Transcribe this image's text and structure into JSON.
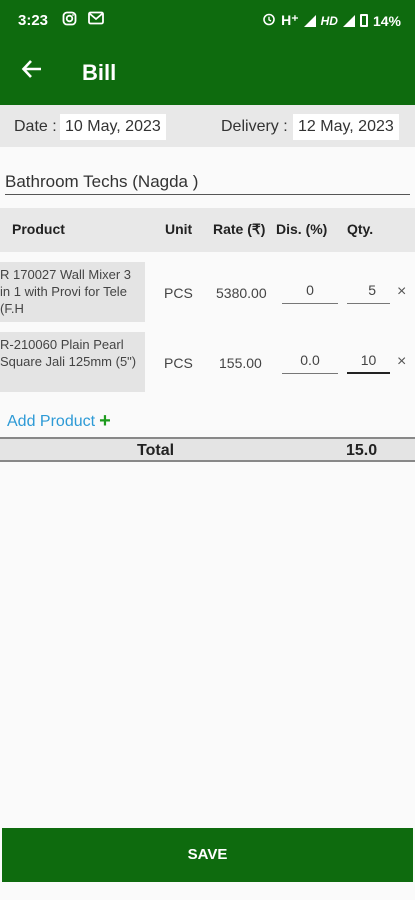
{
  "status_bar": {
    "time": "3:23",
    "network": "H⁺",
    "hd": "HD",
    "battery": "14%"
  },
  "app_bar": {
    "title": "Bill"
  },
  "dates": {
    "date_label": "Date :",
    "date_value": "10 May, 2023",
    "delivery_label": "Delivery :",
    "delivery_value": "12 May, 2023"
  },
  "customer": {
    "name": "Bathroom Techs (Nagda )"
  },
  "table": {
    "headers": {
      "product": "Product",
      "unit": "Unit",
      "rate": "Rate (₹)",
      "discount": "Dis. (%)",
      "qty": "Qty."
    },
    "rows": [
      {
        "product": "R 170027 Wall Mixer 3 in 1 with Provi for Tele (F.H",
        "unit": "PCS",
        "rate": "5380.00",
        "discount": "0",
        "qty": "5"
      },
      {
        "product": "R-210060 Plain Pearl Square Jali 125mm (5\")",
        "unit": "PCS",
        "rate": "155.00",
        "discount": "0.0",
        "qty": "10"
      }
    ],
    "remove_symbol": "×"
  },
  "add_product": {
    "label": "Add Product",
    "plus": "+"
  },
  "total": {
    "label": "Total",
    "value": "15.0"
  },
  "save": {
    "label": "SAVE"
  },
  "colors": {
    "primary": "#0e6b0e",
    "link": "#2d9ad6",
    "plus": "#1e9b1e"
  }
}
